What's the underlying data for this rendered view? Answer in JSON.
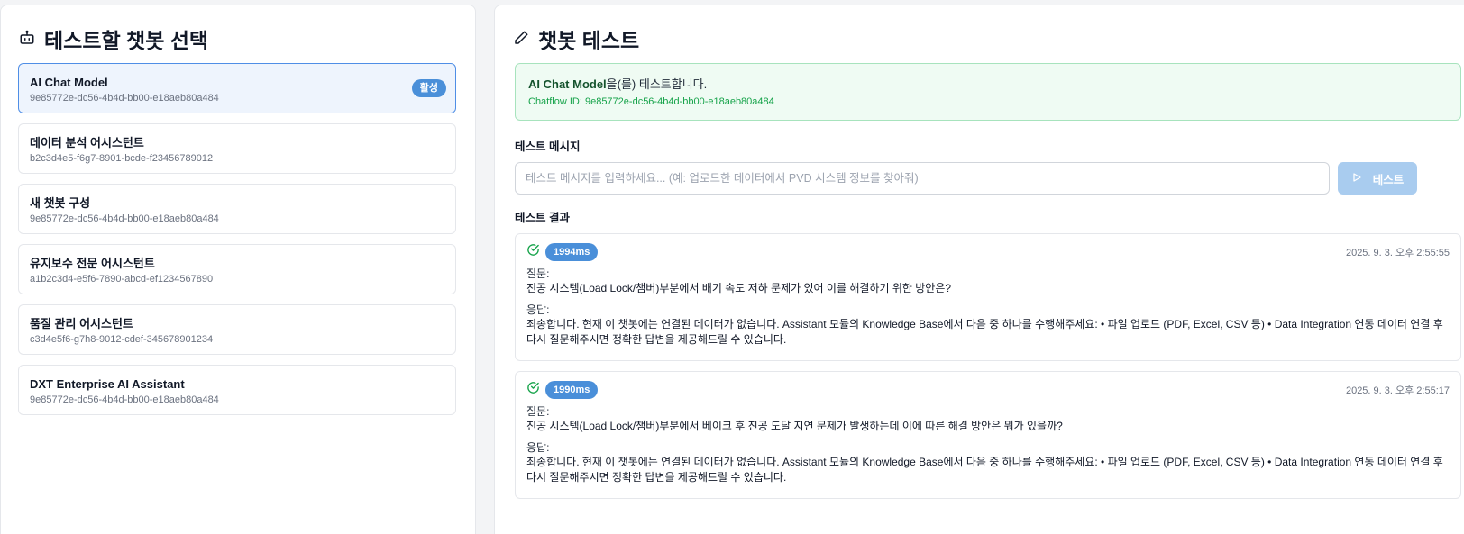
{
  "left_panel": {
    "title": "테스트할 챗봇 선택",
    "chatbots": [
      {
        "name": "AI Chat Model",
        "id": "9e85772e-dc56-4b4d-bb00-e18aeb80a484",
        "badge": "활성"
      },
      {
        "name": "데이터 분석 어시스턴트",
        "id": "b2c3d4e5-f6g7-8901-bcde-f23456789012"
      },
      {
        "name": "새 챗봇 구성",
        "id": "9e85772e-dc56-4b4d-bb00-e18aeb80a484"
      },
      {
        "name": "유지보수 전문 어시스턴트",
        "id": "a1b2c3d4-e5f6-7890-abcd-ef1234567890"
      },
      {
        "name": "품질 관리 어시스턴트",
        "id": "c3d4e5f6-g7h8-9012-cdef-345678901234"
      },
      {
        "name": "DXT Enterprise AI Assistant",
        "id": "9e85772e-dc56-4b4d-bb00-e18aeb80a484"
      }
    ]
  },
  "right_panel": {
    "title": "챗봇 테스트",
    "info": {
      "bot_name": "AI Chat Model",
      "suffix": "을(를) 테스트합니다.",
      "chatflow_id": "Chatflow ID: 9e85772e-dc56-4b4d-bb00-e18aeb80a484"
    },
    "message_label": "테스트 메시지",
    "message_input": {
      "value": "",
      "placeholder": "테스트 메시지를 입력하세요... (예: 업로드한 데이터에서 PVD 시스템 정보를 찾아줘)"
    },
    "test_button_label": "테스트",
    "results_label": "테스트 결과",
    "results": [
      {
        "duration": "1994ms",
        "timestamp": "2025. 9. 3. 오후 2:55:55",
        "question_label": "질문:",
        "question": "진공 시스템(Load Lock/챔버)부분에서 배기 속도 저하 문제가 있어 이를 해결하기 위한 방안은?",
        "answer_label": "응답:",
        "answer": "죄송합니다. 현재 이 챗봇에는 연결된 데이터가 없습니다. Assistant 모듈의 Knowledge Base에서 다음 중 하나를 수행해주세요: • 파일 업로드 (PDF, Excel, CSV 등) • Data Integration 연동 데이터 연결 후 다시 질문해주시면 정확한 답변을 제공해드릴 수 있습니다."
      },
      {
        "duration": "1990ms",
        "timestamp": "2025. 9. 3. 오후 2:55:17",
        "question_label": "질문:",
        "question": "진공 시스템(Load Lock/챔버)부분에서 베이크 후 진공 도달 지연 문제가 발생하는데 이에 따른 해결 방안은 뭐가 있을까?",
        "answer_label": "응답:",
        "answer": "죄송합니다. 현재 이 챗봇에는 연결된 데이터가 없습니다. Assistant 모듈의 Knowledge Base에서 다음 중 하나를 수행해주세요: • 파일 업로드 (PDF, Excel, CSV 등) • Data Integration 연동 데이터 연결 후 다시 질문해주시면 정확한 답변을 제공해드릴 수 있습니다."
      }
    ]
  },
  "icons": {
    "left_title": "robot-icon",
    "right_title": "pencil-icon",
    "result_status": "check-circle-icon",
    "test_button": "play-icon"
  },
  "colors": {
    "accent": "#4a8fd9",
    "active_border": "#4f8ee6",
    "success": "#16a34a",
    "success_bg": "#effbf3"
  }
}
